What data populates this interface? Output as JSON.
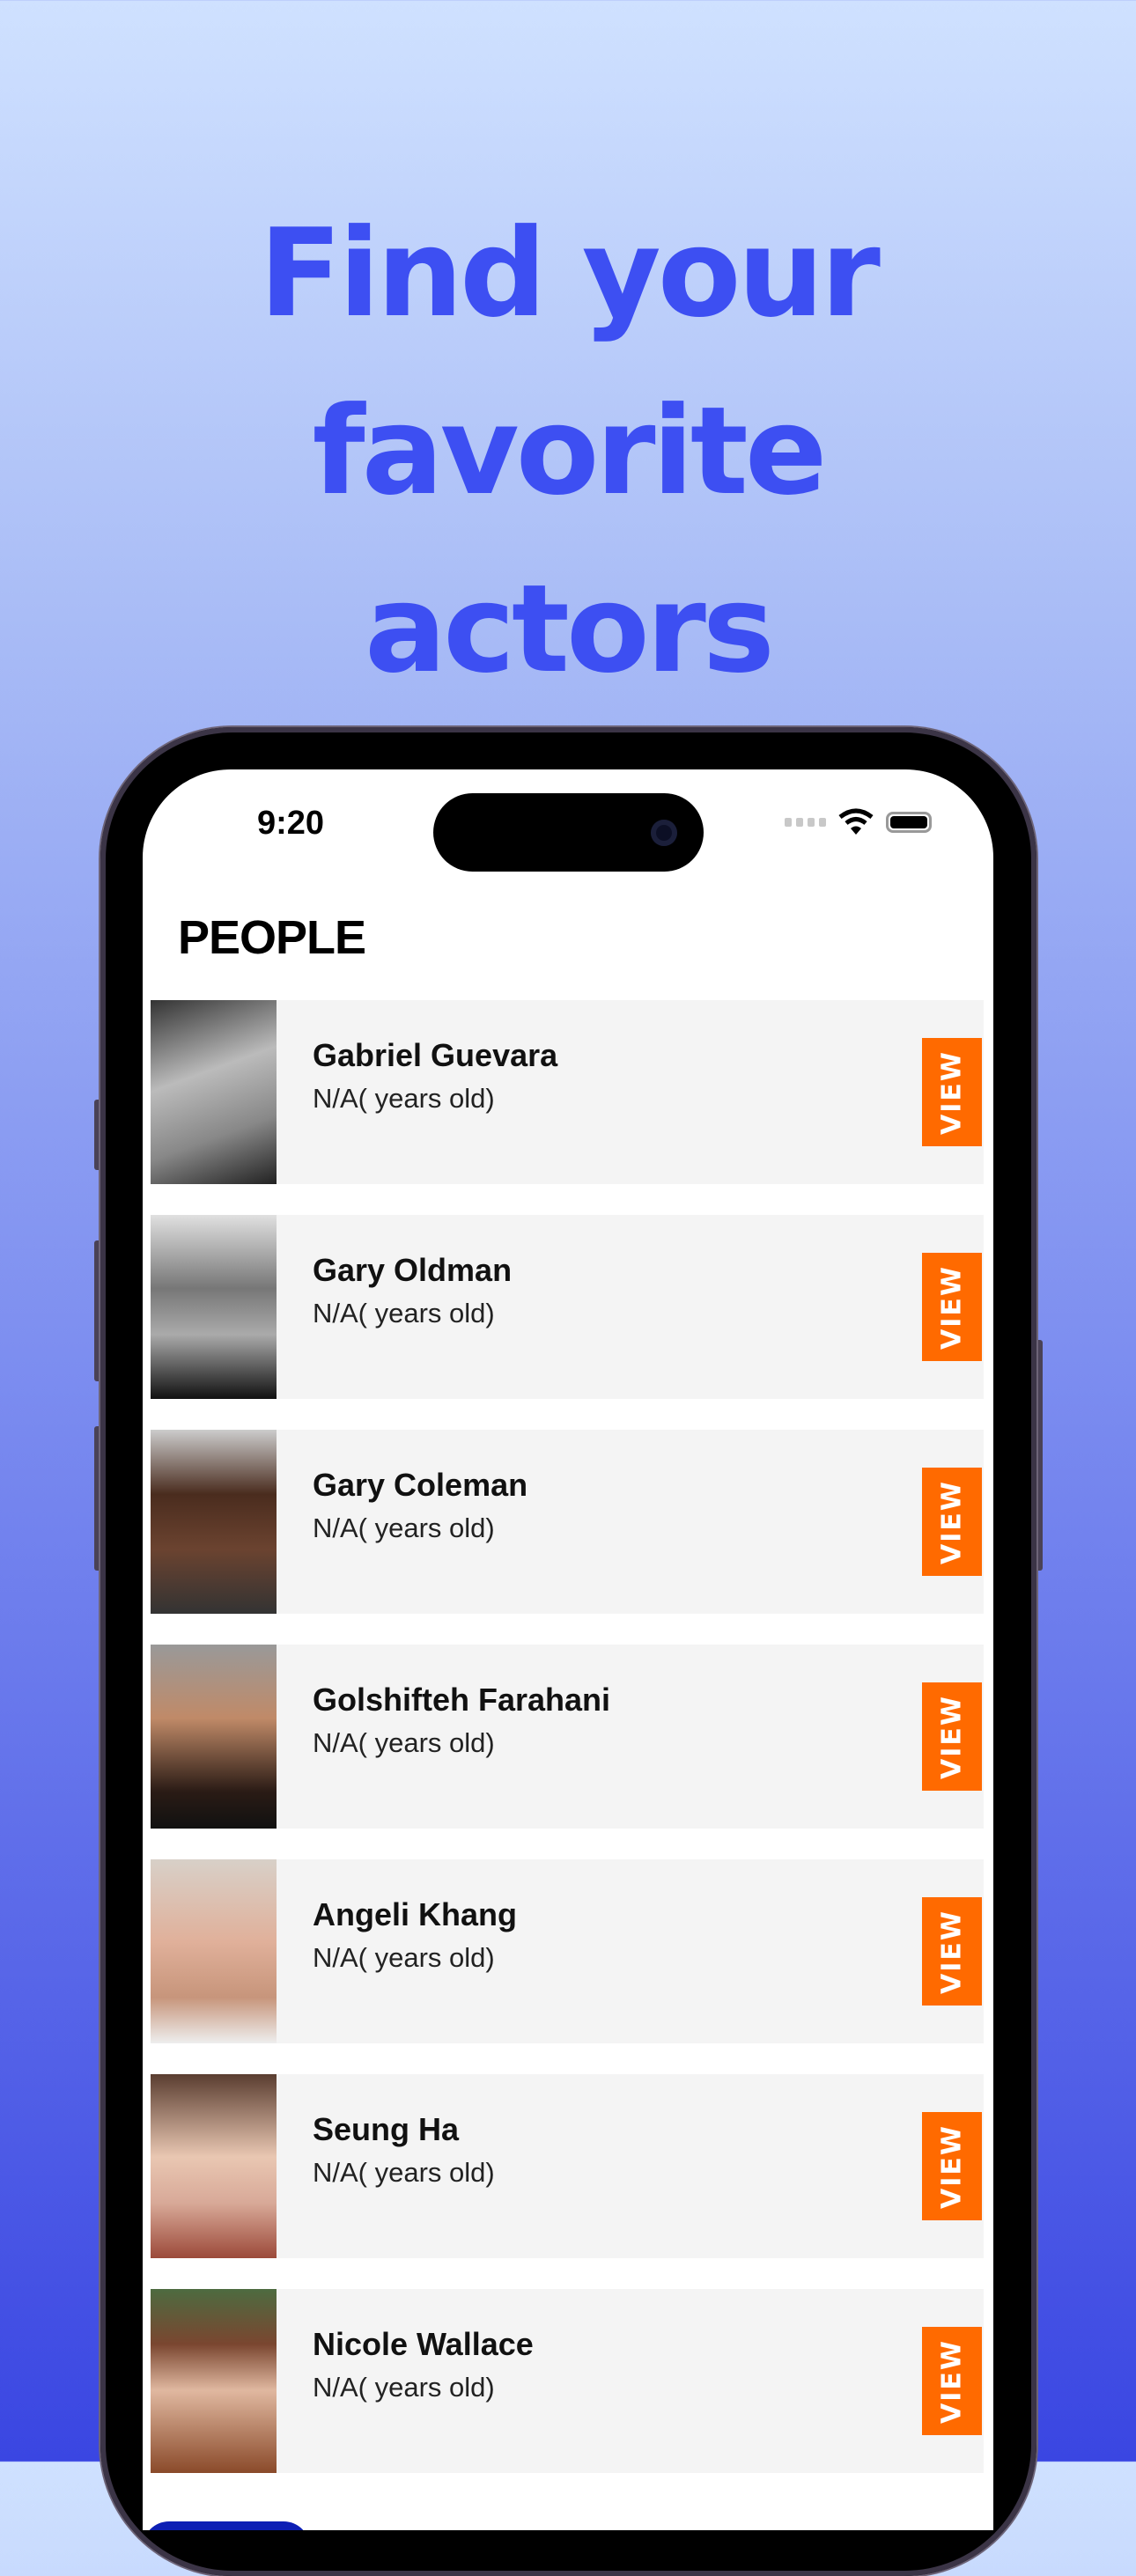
{
  "headline": {
    "line1": "Find your favorite",
    "line2": "actors"
  },
  "status_bar": {
    "time": "9:20"
  },
  "screen": {
    "title": "PEOPLE",
    "view_label": "VIEW",
    "people": [
      {
        "name": "Gabriel Guevara",
        "age": "N/A( years old)"
      },
      {
        "name": "Gary Oldman",
        "age": "N/A( years old)"
      },
      {
        "name": "Gary Coleman",
        "age": "N/A( years old)"
      },
      {
        "name": "Golshifteh Farahani",
        "age": "N/A( years old)"
      },
      {
        "name": "Angeli Khang",
        "age": "N/A( years old)"
      },
      {
        "name": "Seung Ha",
        "age": "N/A( years old)"
      },
      {
        "name": "Nicole Wallace",
        "age": "N/A( years old)"
      }
    ]
  },
  "colors": {
    "accent": "#ff6a00",
    "headline": "#3d4ff2"
  }
}
